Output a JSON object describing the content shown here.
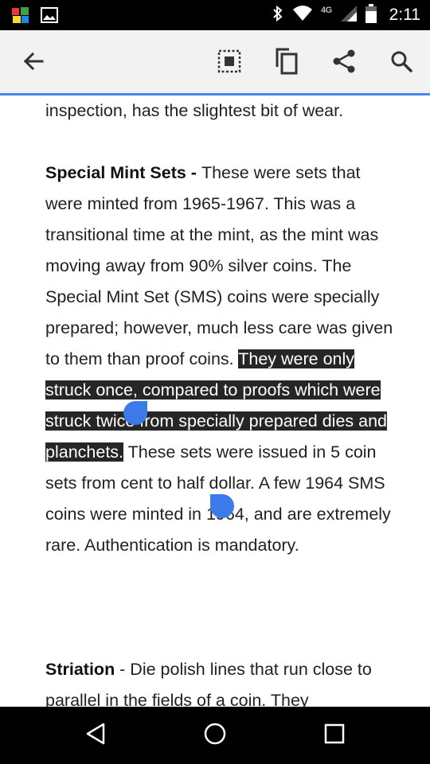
{
  "status_bar": {
    "time": "2:11",
    "network": "4G",
    "icons": [
      "app-notification-icon",
      "image-notification-icon",
      "bluetooth-icon",
      "wifi-icon",
      "cell-signal-icon",
      "battery-icon"
    ]
  },
  "toolbar": {
    "actions": [
      "back-arrow-icon",
      "select-all-icon",
      "copy-icon",
      "share-icon",
      "search-icon"
    ],
    "accent_color": "#4a86e8"
  },
  "content": {
    "p0": "inspection, has the slightest bit of wear.",
    "p1": {
      "term": "Special Mint Sets - ",
      "before": "These were sets that were minted from 1965-1967. This was a transitional time at the mint, as the mint was moving away from 90% silver coins. The Special Mint Set (SMS) coins were specially prepared; however, much less care was given to them than proof coins. ",
      "selected": "They were only struck once, compared to proofs which were struck twice from specially prepared dies and planchets.",
      "after": " These sets were issued in 5 coin sets from cent to half dollar. A few 1964 SMS coins were minted in 1964, and are extremely rare. Authentication is mandatory."
    },
    "p2": {
      "term": "Striation",
      "body": " - Die polish lines that run close to parallel in the fields of a coin. They"
    }
  },
  "selection_color": "#3b7ae8",
  "nav_bar": {
    "buttons": [
      "nav-back-icon",
      "nav-home-icon",
      "nav-recents-icon"
    ]
  }
}
